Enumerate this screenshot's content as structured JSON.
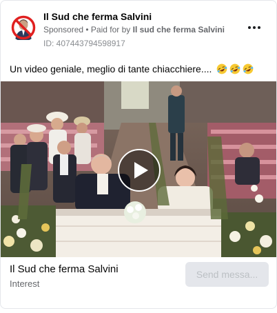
{
  "ad": {
    "page_name": "Il Sud che ferma Salvini",
    "sponsored_label": "Sponsored",
    "separator": " • ",
    "paid_for_prefix": "Paid for by ",
    "paid_for_by": "Il sud che ferma Salvini",
    "id_label": "ID: 407443794598917",
    "caption": "Un video geniale, meglio di tante chiacchiere....",
    "caption_emoji": [
      "rolling-on-floor-laughing",
      "rolling-on-floor-laughing",
      "rolling-on-floor-laughing"
    ]
  },
  "media": {
    "type": "video",
    "state": "paused",
    "play_icon": "play-icon"
  },
  "footer": {
    "title": "Il Sud che ferma Salvini",
    "subtitle": "Interest",
    "cta_label": "Send messa..."
  },
  "colors": {
    "secondary_text": "#65676b",
    "cta_disabled_bg": "#e4e6eb",
    "cta_disabled_text": "#bcc0c4",
    "prohibition_red": "#e02020"
  }
}
